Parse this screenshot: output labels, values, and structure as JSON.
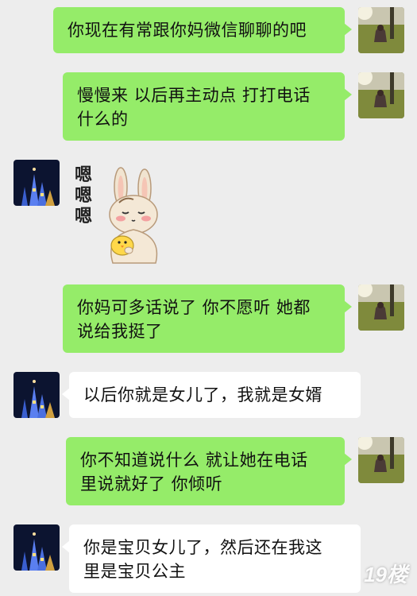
{
  "chat": {
    "messages": [
      {
        "side": "right",
        "type": "text",
        "text": "你现在有常跟你妈微信聊聊的吧"
      },
      {
        "side": "right",
        "type": "text",
        "lines": [
          "慢慢来 以后再主动点 打打电话",
          "什么的"
        ]
      },
      {
        "side": "left",
        "type": "sticker",
        "text": "嗯嗯嗯",
        "chars": [
          "嗯",
          "嗯",
          "嗯"
        ],
        "icon": "bunny-with-chick-sticker"
      },
      {
        "side": "right",
        "type": "text",
        "lines": [
          "你妈可多话说了 你不愿听 她都",
          "说给我挺了"
        ]
      },
      {
        "side": "left",
        "type": "text",
        "text": "以后你就是女儿了，我就是女婿"
      },
      {
        "side": "right",
        "type": "text",
        "lines": [
          "你不知道说什么 就让她在电话",
          "里说就好了 你倾听"
        ]
      },
      {
        "side": "left",
        "type": "text",
        "lines": [
          "你是宝贝女儿了，然后还在我这",
          "里是宝贝公主"
        ]
      }
    ]
  },
  "watermark": "19楼",
  "colors": {
    "background": "#ededed",
    "outgoing_bubble": "#95ec69",
    "incoming_bubble": "#ffffff"
  },
  "avatars": {
    "right": "woman-sitting-on-grass-avatar",
    "left": "night-castle-avatar"
  }
}
